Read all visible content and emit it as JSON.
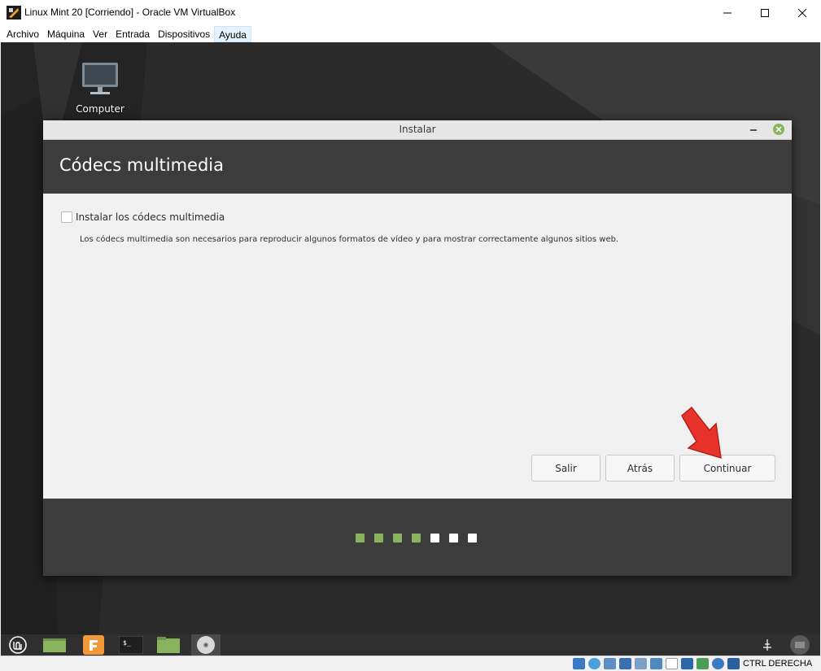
{
  "window": {
    "title": "Linux Mint 20 [Corriendo] - Oracle VM VirtualBox"
  },
  "menubar": {
    "items": [
      "Archivo",
      "Máquina",
      "Ver",
      "Entrada",
      "Dispositivos",
      "Ayuda"
    ],
    "active": "Ayuda"
  },
  "desktop": {
    "icon_label": "Computer"
  },
  "dialog": {
    "title": "Instalar",
    "heading": "Códecs multimedia",
    "checkbox_label": "Instalar los códecs multimedia",
    "checkbox_checked": false,
    "help_text": "Los códecs multimedia son necesarios para reproducir algunos formatos de vídeo y para mostrar correctamente algunos sitios web.",
    "buttons": {
      "quit": "Salir",
      "back": "Atrás",
      "continue": "Continuar"
    },
    "progress": {
      "total_steps": 7,
      "completed_steps": 4,
      "done_color": "#8ab35d",
      "pending_color": "#ffffff"
    }
  },
  "statusbar": {
    "host_key": "CTRL DERECHA"
  },
  "colors": {
    "dialog_header": "#3c3c3c",
    "mint_green": "#8ab35d",
    "annotation_arrow": "#e8332c"
  }
}
